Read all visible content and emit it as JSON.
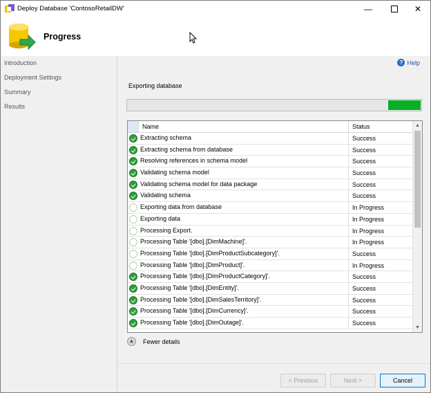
{
  "window": {
    "title": "Deploy Database 'ContosoRetailDW'"
  },
  "header": {
    "title": "Progress"
  },
  "sidebar": {
    "items": [
      {
        "label": "Introduction"
      },
      {
        "label": "Deployment Settings"
      },
      {
        "label": "Summary"
      },
      {
        "label": "Results"
      }
    ]
  },
  "main": {
    "help_label": "Help",
    "status_heading": "Exporting database",
    "progress_fraction": 0.11,
    "columns": {
      "name": "Name",
      "status": "Status"
    },
    "rows": [
      {
        "name": "Extracting schema",
        "status": "Success",
        "icon": "success-check"
      },
      {
        "name": "Extracting schema from database",
        "status": "Success",
        "icon": "success-check"
      },
      {
        "name": "Resolving references in schema model",
        "status": "Success",
        "icon": "success-check"
      },
      {
        "name": "Validating schema model",
        "status": "Success",
        "icon": "success-check"
      },
      {
        "name": "Validating schema model for data package",
        "status": "Success",
        "icon": "success-check"
      },
      {
        "name": "Validating schema",
        "status": "Success",
        "icon": "success-check"
      },
      {
        "name": "Exporting data from database",
        "status": "In Progress",
        "icon": "in-progress-spinner"
      },
      {
        "name": "Exporting data",
        "status": "In Progress",
        "icon": "in-progress-spinner"
      },
      {
        "name": "Processing Export.",
        "status": "In Progress",
        "icon": "in-progress-spinner"
      },
      {
        "name": "Processing Table '[dbo].[DimMachine]'.",
        "status": "In Progress",
        "icon": "in-progress-spinner"
      },
      {
        "name": "Processing Table '[dbo].[DimProductSubcategory]'.",
        "status": "Success",
        "icon": "in-progress-spinner"
      },
      {
        "name": "Processing Table '[dbo].[DimProduct]'.",
        "status": "In Progress",
        "icon": "in-progress-spinner"
      },
      {
        "name": "Processing Table '[dbo].[DimProductCategory]'.",
        "status": "Success",
        "icon": "success-check"
      },
      {
        "name": "Processing Table '[dbo].[DimEntity]'.",
        "status": "Success",
        "icon": "success-check"
      },
      {
        "name": "Processing Table '[dbo].[DimSalesTerritory]'.",
        "status": "Success",
        "icon": "success-check"
      },
      {
        "name": "Processing Table '[dbo].[DimCurrency]'.",
        "status": "Success",
        "icon": "success-check"
      },
      {
        "name": "Processing Table '[dbo].[DimOutage]'.",
        "status": "Success",
        "icon": "success-check"
      }
    ],
    "details_label": "Fewer details"
  },
  "footer": {
    "previous_label": "< Previous",
    "next_label": "Next >",
    "cancel_label": "Cancel"
  }
}
